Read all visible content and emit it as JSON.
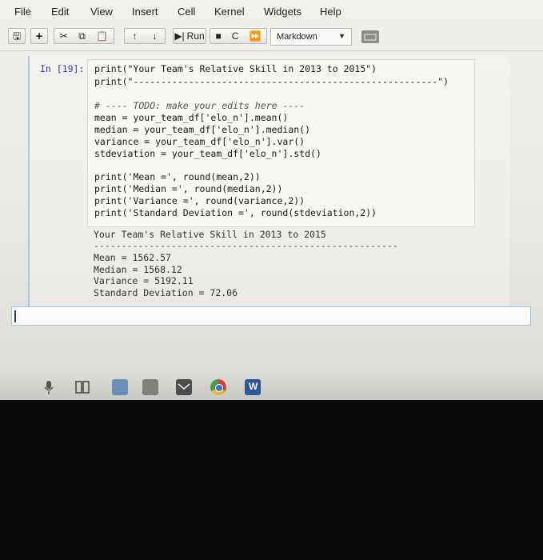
{
  "menubar": {
    "items": [
      "File",
      "Edit",
      "View",
      "Insert",
      "Cell",
      "Kernel",
      "Widgets",
      "Help"
    ]
  },
  "toolbar": {
    "run_label": "Run",
    "cell_type": "Markdown"
  },
  "cell": {
    "prompt": "In [19]:",
    "code_lines": [
      "print(\"Your Team's Relative Skill in 2013 to 2015\")",
      "print(\"-------------------------------------------------------\")",
      "",
      "# ---- TODO: make your edits here ----",
      "mean = your_team_df['elo_n'].mean()",
      "median = your_team_df['elo_n'].median()",
      "variance = your_team_df['elo_n'].var()",
      "stdeviation = your_team_df['elo_n'].std()",
      "",
      "print('Mean =', round(mean,2))",
      "print('Median =', round(median,2))",
      "print('Variance =', round(variance,2))",
      "print('Standard Deviation =', round(stdeviation,2))"
    ],
    "output_lines": [
      "Your Team's Relative Skill in 2013 to 2015",
      "-------------------------------------------------------",
      "Mean = 1562.57",
      "Median = 1568.12",
      "Variance = 5192.11",
      "Standard Deviation = 72.06"
    ]
  },
  "taskbar": {
    "icons": [
      "microphone-icon",
      "task-view-icon",
      "file-explorer-icon",
      "store-icon",
      "mail-icon",
      "chrome-icon",
      "word-icon"
    ]
  },
  "colors": {
    "prompt": "#303f9f",
    "cell_border": "#a5c8e4",
    "dark_bezel": "#0b0a09"
  }
}
